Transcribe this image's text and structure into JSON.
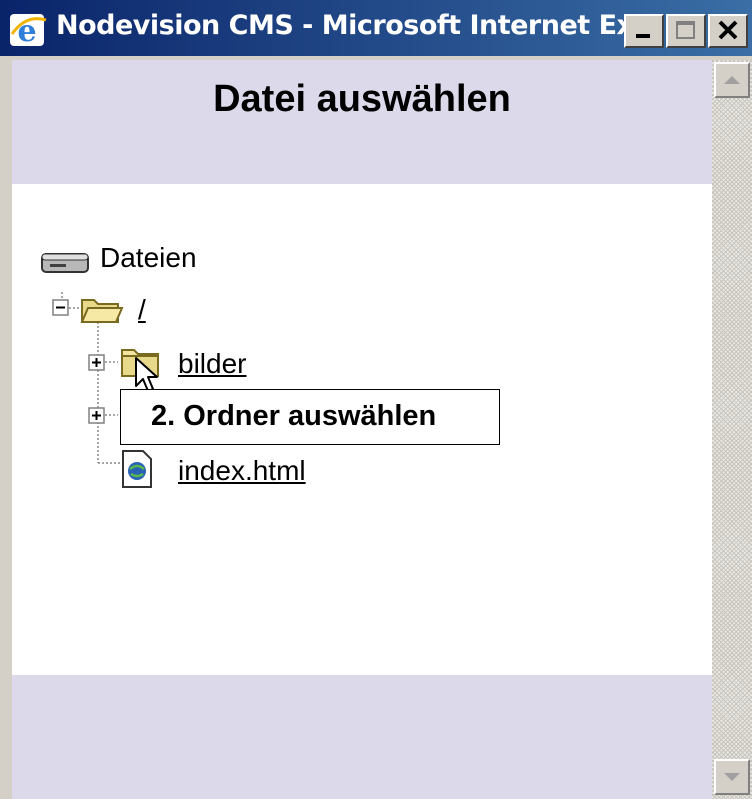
{
  "window": {
    "title": "Nodevision CMS - Microsoft Internet Ex...",
    "minimize_icon": "minimize-icon",
    "maximize_icon": "maximize-icon",
    "close_icon": "close-icon"
  },
  "page": {
    "title": "Datei auswählen"
  },
  "tree": {
    "root_label": "Dateien",
    "root_icon": "drive-icon",
    "folder_root": "/",
    "items": [
      {
        "label": "bilder",
        "icon": "folder-icon"
      },
      {
        "label": "",
        "icon": "folder-icon"
      },
      {
        "label": "index.html",
        "icon": "html-file-icon"
      }
    ]
  },
  "tooltip": {
    "text": "2. Ordner auswählen"
  },
  "colors": {
    "titlebar_start": "#0a246a",
    "titlebar_end": "#3a6ea5",
    "band": "#dcdaea",
    "chrome": "#d4d0c8"
  }
}
